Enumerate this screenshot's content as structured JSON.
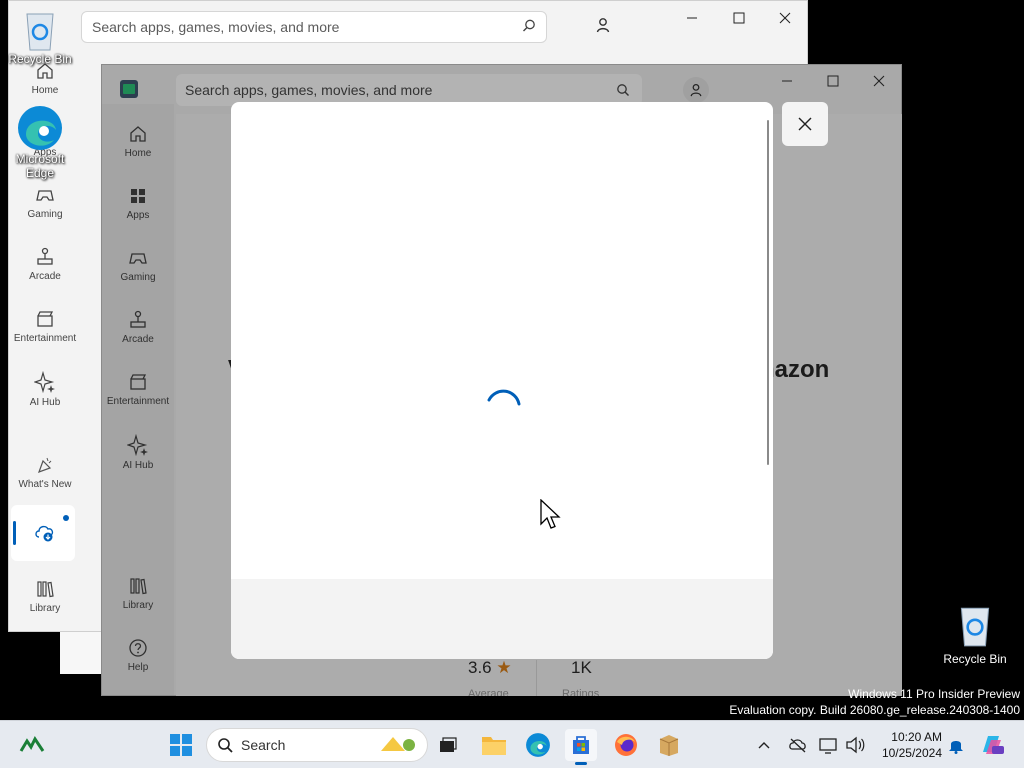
{
  "back_window": {
    "search_placeholder": "Search apps, games, movies, and more",
    "nav": [
      {
        "label": "Home"
      },
      {
        "label": "Apps"
      },
      {
        "label": "Gaming"
      },
      {
        "label": "Arcade"
      },
      {
        "label": "Entertainment"
      },
      {
        "label": "AI Hub"
      },
      {
        "label": "What's New"
      },
      {
        "label": "Library"
      }
    ]
  },
  "front_window": {
    "search_placeholder": "Search apps, games, movies, and more",
    "nav": [
      {
        "label": "Home"
      },
      {
        "label": "Apps"
      },
      {
        "label": "Gaming"
      },
      {
        "label": "Arcade"
      },
      {
        "label": "Entertainment"
      },
      {
        "label": "AI Hub"
      },
      {
        "label": "Library"
      },
      {
        "label": "Help"
      }
    ],
    "bg_partial_title": "nazon",
    "bg_partial_left": "v",
    "rating_value": "3.6",
    "rating_caption": "Average",
    "ratings_count": "1K",
    "ratings_caption": "Ratings"
  },
  "dialog": {
    "state": "loading",
    "accent": "#005fb8"
  },
  "desktop": {
    "icons": [
      {
        "label": "Recycle Bin"
      },
      {
        "label": "Microsoft Edge"
      },
      {
        "label": "Recycle Bin"
      }
    ],
    "watermark_line1": "Windows 11 Pro Insider Preview",
    "watermark_line2": "Evaluation copy. Build 26080.ge_release.240308-1400"
  },
  "taskbar": {
    "search_label": "Search",
    "time": "10:20 AM",
    "date": "10/25/2024"
  }
}
